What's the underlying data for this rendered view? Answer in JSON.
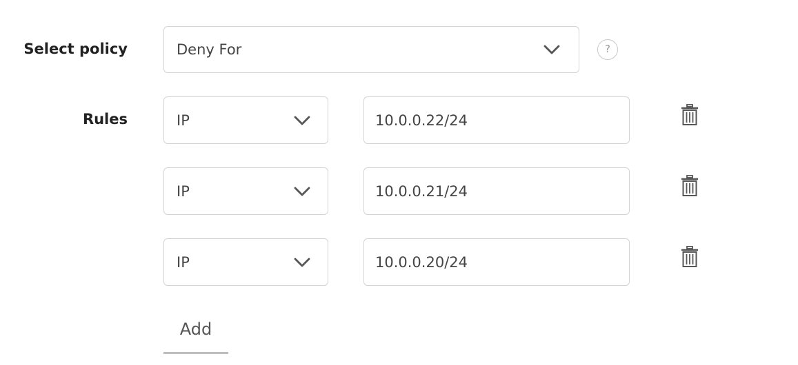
{
  "policy": {
    "label": "Select policy",
    "selected": "Deny For",
    "help_glyph": "?"
  },
  "rules": {
    "label": "Rules",
    "items": [
      {
        "type": "IP",
        "value": "10.0.0.22/24"
      },
      {
        "type": "IP",
        "value": "10.0.0.21/24"
      },
      {
        "type": "IP",
        "value": "10.0.0.20/24"
      }
    ],
    "add_label": "Add"
  },
  "icons": {
    "chevron": "chevron-down-icon",
    "help": "help-icon",
    "delete": "trash-icon"
  },
  "colors": {
    "border": "#d4d4d4",
    "text": "#444444",
    "icon": "#555555"
  }
}
